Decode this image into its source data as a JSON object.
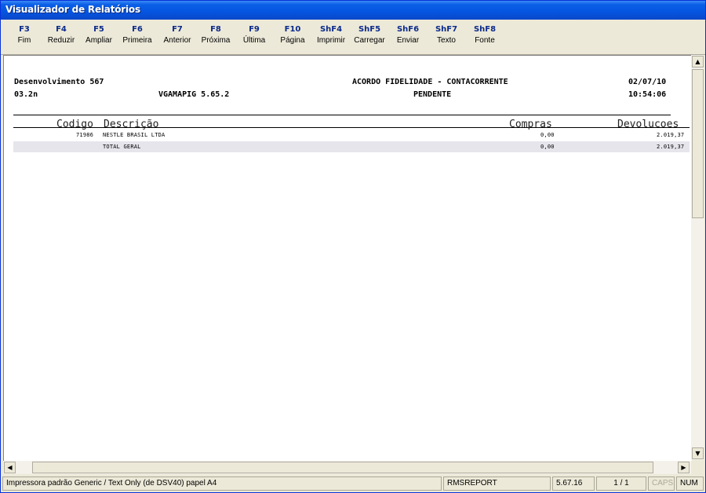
{
  "window": {
    "title": "Visualizador de Relatórios"
  },
  "toolbar": {
    "buttons": [
      {
        "key": "F3",
        "label": "Fim"
      },
      {
        "key": "F4",
        "label": "Reduzir"
      },
      {
        "key": "F5",
        "label": "Ampliar"
      },
      {
        "key": "F6",
        "label": "Primeira"
      },
      {
        "key": "F7",
        "label": "Anterior"
      },
      {
        "key": "F8",
        "label": "Próxima"
      },
      {
        "key": "F9",
        "label": "Última"
      },
      {
        "key": "F10",
        "label": "Página"
      },
      {
        "key": "ShF4",
        "label": "Imprimir"
      },
      {
        "key": "ShF5",
        "label": "Carregar"
      },
      {
        "key": "ShF6",
        "label": "Enviar"
      },
      {
        "key": "ShF7",
        "label": "Texto"
      },
      {
        "key": "ShF8",
        "label": "Fonte"
      }
    ]
  },
  "report": {
    "header": {
      "left1": "Desenvolvimento 567",
      "left2": "03.2n",
      "program": "VGAMAPIG 5.65.2",
      "title": "ACORDO FIDELIDADE - CONTACORRENTE",
      "subtitle": "PENDENTE",
      "date": "02/07/10",
      "time": "10:54:06"
    },
    "columns": {
      "codigo": "Codigo",
      "descricao": "Descrição",
      "compras": "Compras",
      "devolucoes": "Devolucoes"
    },
    "rows": [
      {
        "codigo": "71986",
        "descricao": "NESTLE BRASIL LTDA",
        "compras": "0,00",
        "devolucoes": "2.019,37"
      }
    ],
    "total": {
      "label": "TOTAL GERAL",
      "compras": "0,00",
      "devolucoes": "2.019,37"
    }
  },
  "scroll": {
    "up_arrow": "▲",
    "down_arrow": "▼",
    "left_arrow": "◀",
    "right_arrow": "▶"
  },
  "statusbar": {
    "printer": "Impressora padrão Generic / Text Only (de DSV40) papel A4",
    "module": "RMSREPORT",
    "version": "5.67.16",
    "page": "1 / 1",
    "caps": "CAPS",
    "num": "NUM"
  }
}
